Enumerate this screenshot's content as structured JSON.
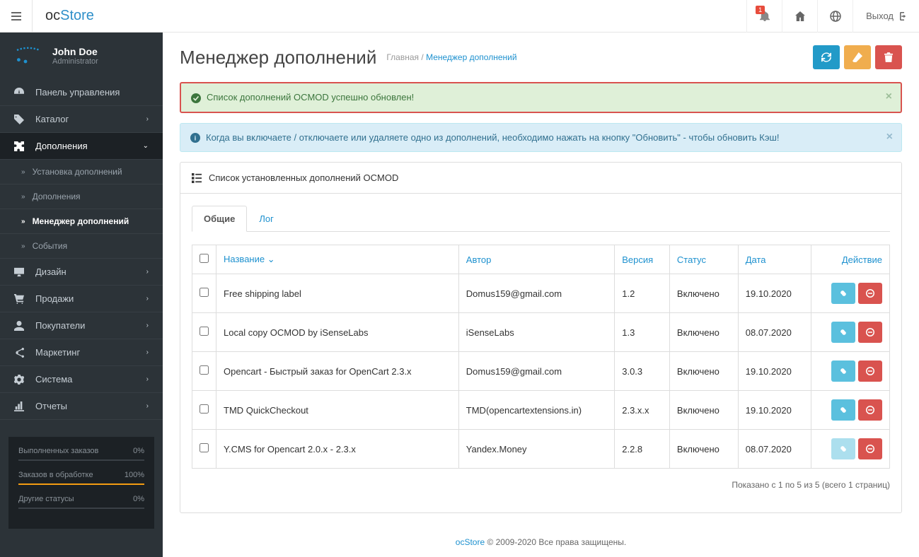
{
  "top": {
    "logo1": "oc",
    "logo2": "Store",
    "notif_count": "1",
    "logout": "Выход"
  },
  "user": {
    "name": "John Doe",
    "role": "Administrator"
  },
  "nav": {
    "dashboard": "Панель управления",
    "catalog": "Каталог",
    "extensions": "Дополнения",
    "sub_install": "Установка дополнений",
    "sub_ext": "Дополнения",
    "sub_mod": "Менеджер дополнений",
    "sub_event": "События",
    "design": "Дизайн",
    "sales": "Продажи",
    "customers": "Покупатели",
    "marketing": "Маркетинг",
    "system": "Система",
    "reports": "Отчеты"
  },
  "stats": {
    "s1_label": "Выполненных заказов",
    "s1_val": "0%",
    "s2_label": "Заказов в обработке",
    "s2_val": "100%",
    "s3_label": "Другие статусы",
    "s3_val": "0%"
  },
  "page": {
    "title": "Менеджер дополнений",
    "bc_home": "Главная",
    "bc_sep": " / ",
    "bc_current": "Менеджер дополнений"
  },
  "alerts": {
    "success": "Список дополнений OCMOD успешно обновлен!",
    "info": "Когда вы включаете / отключаете или удаляете одно из дополнений, необходимо нажать на кнопку \"Обновить\" - чтобы обновить Кэш!"
  },
  "panel": {
    "title": "Список установленных дополнений OCMOD",
    "tab_general": "Общие",
    "tab_log": "Лог"
  },
  "table": {
    "col_name": "Название",
    "col_author": "Автор",
    "col_version": "Версия",
    "col_status": "Статус",
    "col_date": "Дата",
    "col_action": "Действие",
    "rows": [
      {
        "name": "Free shipping label",
        "author": "Domus159@gmail.com",
        "version": "1.2",
        "status": "Включено",
        "date": "19.10.2020",
        "dim": false
      },
      {
        "name": "Local copy OCMOD by iSenseLabs",
        "author": "iSenseLabs",
        "version": "1.3",
        "status": "Включено",
        "date": "08.07.2020",
        "dim": false
      },
      {
        "name": "Opencart - Быстрый заказ for OpenCart 2.3.x",
        "author": "Domus159@gmail.com",
        "version": "3.0.3",
        "status": "Включено",
        "date": "19.10.2020",
        "dim": false
      },
      {
        "name": "TMD QuickCheckout",
        "author": "TMD(opencartextensions.in)",
        "version": "2.3.x.x",
        "status": "Включено",
        "date": "19.10.2020",
        "dim": false
      },
      {
        "name": "Y.CMS for Opencart 2.0.x - 2.3.x",
        "author": "Yandex.Money",
        "version": "2.2.8",
        "status": "Включено",
        "date": "08.07.2020",
        "dim": true
      }
    ],
    "pagination": "Показано с 1 по 5 из 5 (всего 1 страниц)"
  },
  "footer": {
    "brand": "ocStore",
    "text": " © 2009-2020 Все права защищены."
  }
}
